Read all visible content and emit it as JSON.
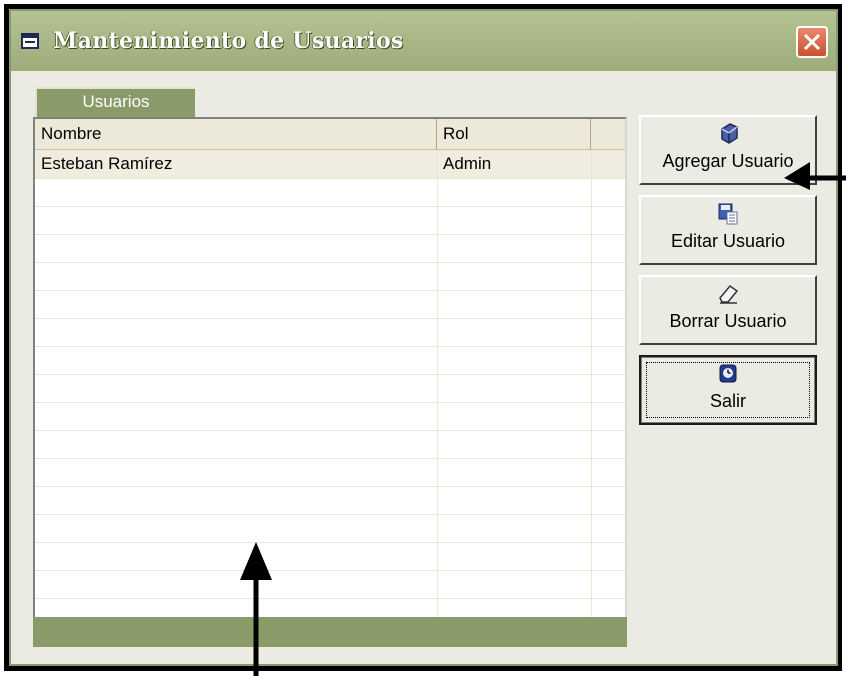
{
  "window": {
    "title": "Mantenimiento de Usuarios",
    "close_label": "close"
  },
  "tab": {
    "label": "Usuarios"
  },
  "grid": {
    "columns": [
      "Nombre",
      "Rol"
    ],
    "rows": [
      {
        "nombre": "Esteban Ramírez",
        "rol": "Admin"
      }
    ]
  },
  "buttons": {
    "agregar": "Agregar Usuario",
    "editar": "Editar Usuario",
    "borrar": "Borrar Usuario",
    "salir": "Salir"
  },
  "icons": {
    "title": "form-icon",
    "agregar": "add-user-icon",
    "editar": "edit-save-icon",
    "borrar": "eraser-icon",
    "salir": "exit-clock-icon",
    "close": "close-icon"
  },
  "colors": {
    "titlebar": "#9eab7a",
    "accent": "#8a9a68",
    "close": "#d0603c"
  }
}
